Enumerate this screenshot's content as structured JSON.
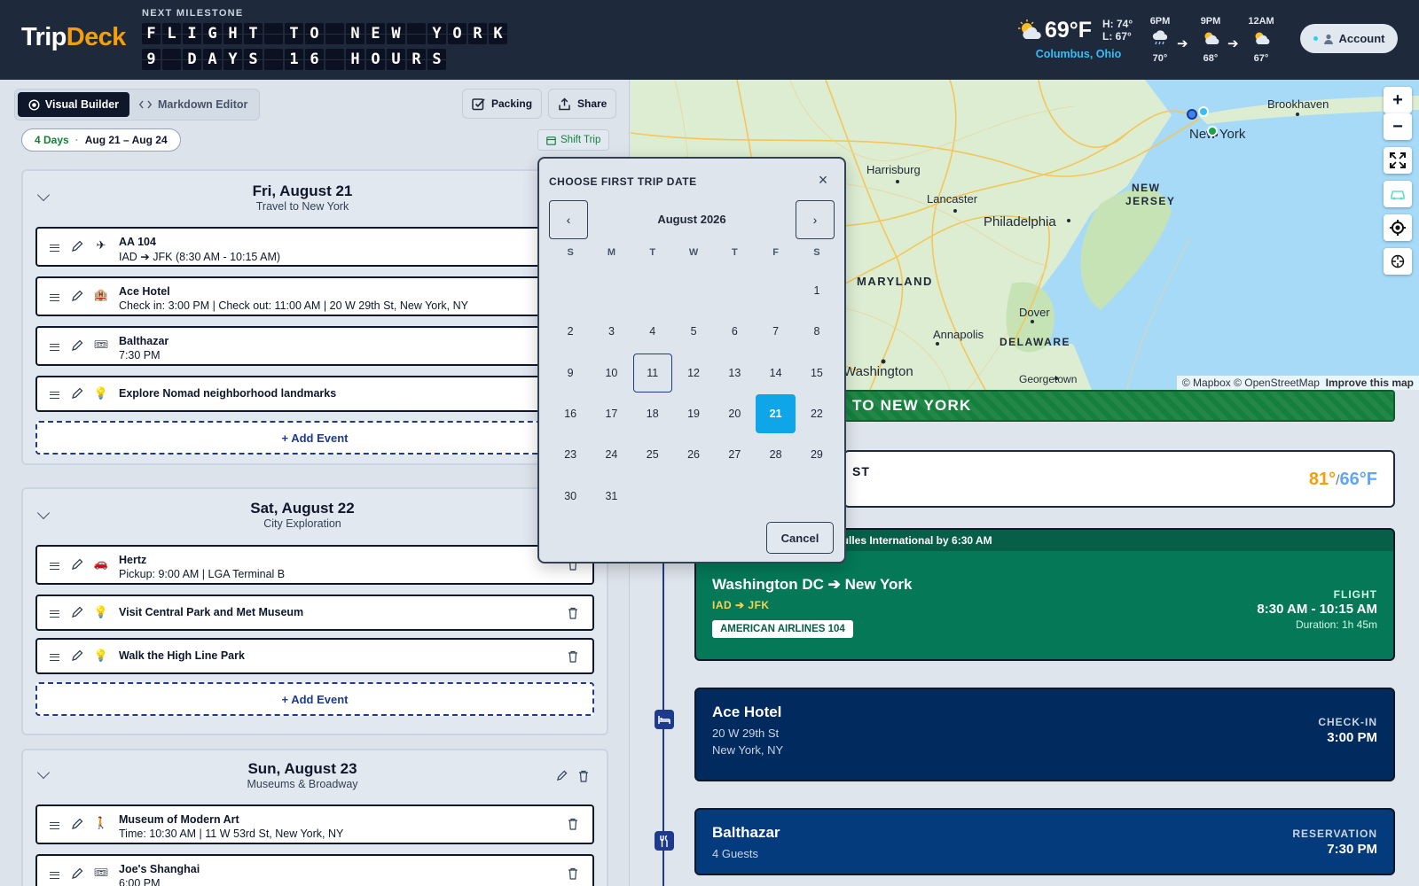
{
  "header": {
    "logo_part1": "Trip",
    "logo_part2": "Deck",
    "milestone_label": "NEXT MILESTONE",
    "flap_line1": "FLIGHT TO NEW YORK",
    "flap_line2": "9 DAYS 16 HOURS",
    "weather": {
      "temp": "69°F",
      "high": "H: 74°",
      "low": "L: 67°",
      "city": "Columbus, Ohio",
      "forecast": [
        {
          "time": "6PM",
          "temp": "70°",
          "icon": "rain-cloud-icon"
        },
        {
          "time": "9PM",
          "temp": "68°",
          "icon": "partly-cloudy-icon"
        },
        {
          "time": "12AM",
          "temp": "67°",
          "icon": "partly-cloudy-icon"
        }
      ],
      "arrow": "➔"
    },
    "account_label": "Account"
  },
  "toolbar": {
    "visual_builder": "Visual Builder",
    "markdown_editor": "Markdown Editor",
    "packing": "Packing",
    "share": "Share"
  },
  "trip": {
    "days": "4 Days",
    "sep": "·",
    "range": "Aug 21 – Aug 24",
    "shift_trip": "Shift Trip"
  },
  "days": [
    {
      "title": "Fri, August 21",
      "subtitle": "Travel to New York",
      "add_event": "+ Add Event",
      "events": [
        {
          "title": "AA 104",
          "subtitle": "IAD ➔ JFK (8:30 AM - 10:15 AM)",
          "icon": "✈",
          "icon_name": "plane-icon"
        },
        {
          "title": "Ace Hotel",
          "subtitle": "Check in: 3:00 PM | Check out: 11:00 AM | 20 W 29th St, New York, NY",
          "icon": "🏨",
          "icon_name": "hotel-icon"
        },
        {
          "title": "Balthazar",
          "subtitle": "7:30 PM",
          "icon": "🎟",
          "icon_name": "ticket-icon"
        },
        {
          "title": "Explore Nomad neighborhood landmarks",
          "subtitle": "",
          "icon": "💡",
          "icon_name": "lightbulb-icon"
        }
      ]
    },
    {
      "title": "Sat, August 22",
      "subtitle": "City Exploration",
      "add_event": "+ Add Event",
      "events": [
        {
          "title": "Hertz",
          "subtitle": "Pickup: 9:00 AM | LGA Terminal B",
          "icon": "🚗",
          "icon_name": "car-icon"
        },
        {
          "title": "Visit Central Park and Met Museum",
          "subtitle": "",
          "icon": "💡",
          "icon_name": "lightbulb-icon"
        },
        {
          "title": "Walk the High Line Park",
          "subtitle": "",
          "icon": "💡",
          "icon_name": "lightbulb-icon"
        }
      ]
    },
    {
      "title": "Sun, August 23",
      "subtitle": "Museums & Broadway",
      "events": [
        {
          "title": "Museum of Modern Art",
          "subtitle": "Time: 10:30 AM | 11 W 53rd St, New York, NY",
          "icon": "🚶",
          "icon_name": "walking-icon"
        },
        {
          "title": "Joe's Shanghai",
          "subtitle": "6:00 PM",
          "icon": "🎟",
          "icon_name": "ticket-icon"
        }
      ]
    }
  ],
  "datepicker": {
    "title": "CHOOSE FIRST TRIP DATE",
    "close": "×",
    "prev": "‹",
    "next": "›",
    "month": "August 2026",
    "weekdays": [
      "S",
      "M",
      "T",
      "W",
      "T",
      "F",
      "S"
    ],
    "days": [
      "1",
      "2",
      "3",
      "4",
      "5",
      "6",
      "7",
      "8",
      "9",
      "10",
      "11",
      "12",
      "13",
      "14",
      "15",
      "16",
      "17",
      "18",
      "19",
      "20",
      "21",
      "22",
      "23",
      "24",
      "25",
      "26",
      "27",
      "28",
      "29",
      "30",
      "31"
    ],
    "today": "11",
    "selected": "21",
    "cancel": "Cancel"
  },
  "map": {
    "labels": [
      "Brookhaven",
      "New York",
      "Harrisburg",
      "NEW JERSEY",
      "Lancaster",
      "Philadelphia",
      "MARYLAND",
      "Dover",
      "Annapolis",
      "DELAWARE",
      "Washington",
      "Georgetown"
    ],
    "attribution": "© Mapbox © OpenStreetMap",
    "improve": "Improve this map",
    "zoom_in": "+",
    "zoom_out": "−"
  },
  "timeline": {
    "banner": "TO NEW YORK",
    "weather_name": "ST",
    "weather_hi": "81°",
    "weather_sep": "/",
    "weather_lo": "66°F",
    "flight": {
      "strip": "Dulles International by 6:30 AM",
      "route": "Washington DC ➔ New York",
      "codes": "IAD ➔ JFK",
      "badge": "AMERICAN AIRLINES 104",
      "label": "FLIGHT",
      "time": "8:30 AM - 10:15 AM",
      "duration": "Duration: 1h 45m"
    },
    "hotel": {
      "name": "Ace Hotel",
      "addr1": "20 W 29th St",
      "addr2": "New York, NY",
      "label": "CHECK-IN",
      "time": "3:00 PM"
    },
    "reservation": {
      "name": "Balthazar",
      "guests": "4 Guests",
      "label": "RESERVATION",
      "time": "7:30 PM"
    }
  },
  "colors": {
    "header_bg": "#1e293b",
    "accent_orange": "#f59e0b",
    "flight_green": "#047857",
    "hotel_navy": "#012a5e",
    "reservation_blue": "#043b7c",
    "selected_day": "#0ea5e9"
  }
}
